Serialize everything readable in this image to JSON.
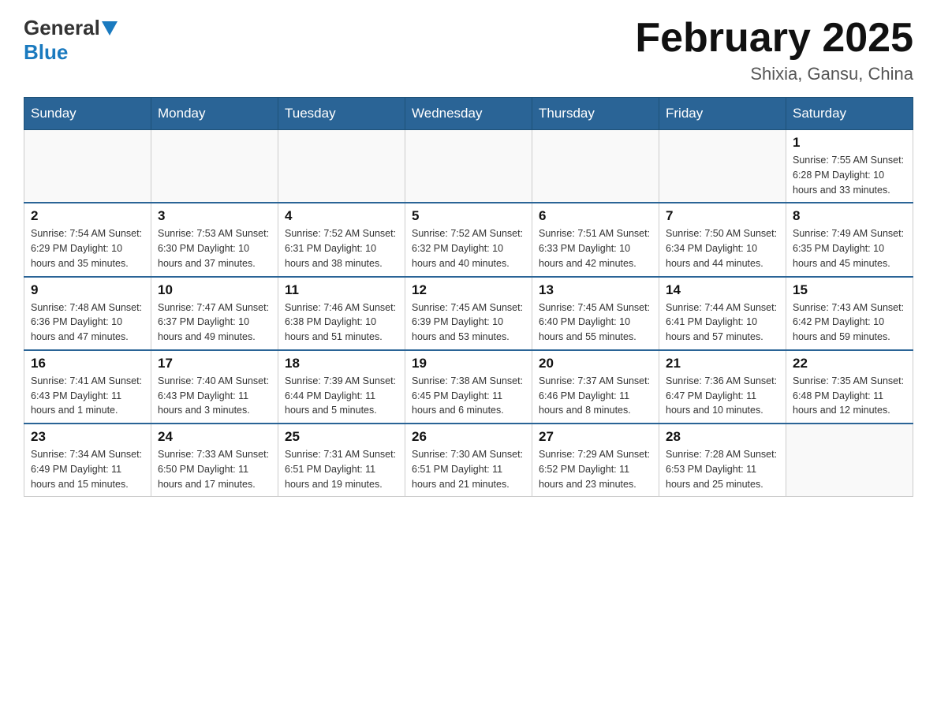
{
  "logo": {
    "general": "General",
    "blue": "Blue"
  },
  "header": {
    "month": "February 2025",
    "location": "Shixia, Gansu, China"
  },
  "weekdays": [
    "Sunday",
    "Monday",
    "Tuesday",
    "Wednesday",
    "Thursday",
    "Friday",
    "Saturday"
  ],
  "weeks": [
    [
      {
        "day": "",
        "info": ""
      },
      {
        "day": "",
        "info": ""
      },
      {
        "day": "",
        "info": ""
      },
      {
        "day": "",
        "info": ""
      },
      {
        "day": "",
        "info": ""
      },
      {
        "day": "",
        "info": ""
      },
      {
        "day": "1",
        "info": "Sunrise: 7:55 AM\nSunset: 6:28 PM\nDaylight: 10 hours and 33 minutes."
      }
    ],
    [
      {
        "day": "2",
        "info": "Sunrise: 7:54 AM\nSunset: 6:29 PM\nDaylight: 10 hours and 35 minutes."
      },
      {
        "day": "3",
        "info": "Sunrise: 7:53 AM\nSunset: 6:30 PM\nDaylight: 10 hours and 37 minutes."
      },
      {
        "day": "4",
        "info": "Sunrise: 7:52 AM\nSunset: 6:31 PM\nDaylight: 10 hours and 38 minutes."
      },
      {
        "day": "5",
        "info": "Sunrise: 7:52 AM\nSunset: 6:32 PM\nDaylight: 10 hours and 40 minutes."
      },
      {
        "day": "6",
        "info": "Sunrise: 7:51 AM\nSunset: 6:33 PM\nDaylight: 10 hours and 42 minutes."
      },
      {
        "day": "7",
        "info": "Sunrise: 7:50 AM\nSunset: 6:34 PM\nDaylight: 10 hours and 44 minutes."
      },
      {
        "day": "8",
        "info": "Sunrise: 7:49 AM\nSunset: 6:35 PM\nDaylight: 10 hours and 45 minutes."
      }
    ],
    [
      {
        "day": "9",
        "info": "Sunrise: 7:48 AM\nSunset: 6:36 PM\nDaylight: 10 hours and 47 minutes."
      },
      {
        "day": "10",
        "info": "Sunrise: 7:47 AM\nSunset: 6:37 PM\nDaylight: 10 hours and 49 minutes."
      },
      {
        "day": "11",
        "info": "Sunrise: 7:46 AM\nSunset: 6:38 PM\nDaylight: 10 hours and 51 minutes."
      },
      {
        "day": "12",
        "info": "Sunrise: 7:45 AM\nSunset: 6:39 PM\nDaylight: 10 hours and 53 minutes."
      },
      {
        "day": "13",
        "info": "Sunrise: 7:45 AM\nSunset: 6:40 PM\nDaylight: 10 hours and 55 minutes."
      },
      {
        "day": "14",
        "info": "Sunrise: 7:44 AM\nSunset: 6:41 PM\nDaylight: 10 hours and 57 minutes."
      },
      {
        "day": "15",
        "info": "Sunrise: 7:43 AM\nSunset: 6:42 PM\nDaylight: 10 hours and 59 minutes."
      }
    ],
    [
      {
        "day": "16",
        "info": "Sunrise: 7:41 AM\nSunset: 6:43 PM\nDaylight: 11 hours and 1 minute."
      },
      {
        "day": "17",
        "info": "Sunrise: 7:40 AM\nSunset: 6:43 PM\nDaylight: 11 hours and 3 minutes."
      },
      {
        "day": "18",
        "info": "Sunrise: 7:39 AM\nSunset: 6:44 PM\nDaylight: 11 hours and 5 minutes."
      },
      {
        "day": "19",
        "info": "Sunrise: 7:38 AM\nSunset: 6:45 PM\nDaylight: 11 hours and 6 minutes."
      },
      {
        "day": "20",
        "info": "Sunrise: 7:37 AM\nSunset: 6:46 PM\nDaylight: 11 hours and 8 minutes."
      },
      {
        "day": "21",
        "info": "Sunrise: 7:36 AM\nSunset: 6:47 PM\nDaylight: 11 hours and 10 minutes."
      },
      {
        "day": "22",
        "info": "Sunrise: 7:35 AM\nSunset: 6:48 PM\nDaylight: 11 hours and 12 minutes."
      }
    ],
    [
      {
        "day": "23",
        "info": "Sunrise: 7:34 AM\nSunset: 6:49 PM\nDaylight: 11 hours and 15 minutes."
      },
      {
        "day": "24",
        "info": "Sunrise: 7:33 AM\nSunset: 6:50 PM\nDaylight: 11 hours and 17 minutes."
      },
      {
        "day": "25",
        "info": "Sunrise: 7:31 AM\nSunset: 6:51 PM\nDaylight: 11 hours and 19 minutes."
      },
      {
        "day": "26",
        "info": "Sunrise: 7:30 AM\nSunset: 6:51 PM\nDaylight: 11 hours and 21 minutes."
      },
      {
        "day": "27",
        "info": "Sunrise: 7:29 AM\nSunset: 6:52 PM\nDaylight: 11 hours and 23 minutes."
      },
      {
        "day": "28",
        "info": "Sunrise: 7:28 AM\nSunset: 6:53 PM\nDaylight: 11 hours and 25 minutes."
      },
      {
        "day": "",
        "info": ""
      }
    ]
  ]
}
